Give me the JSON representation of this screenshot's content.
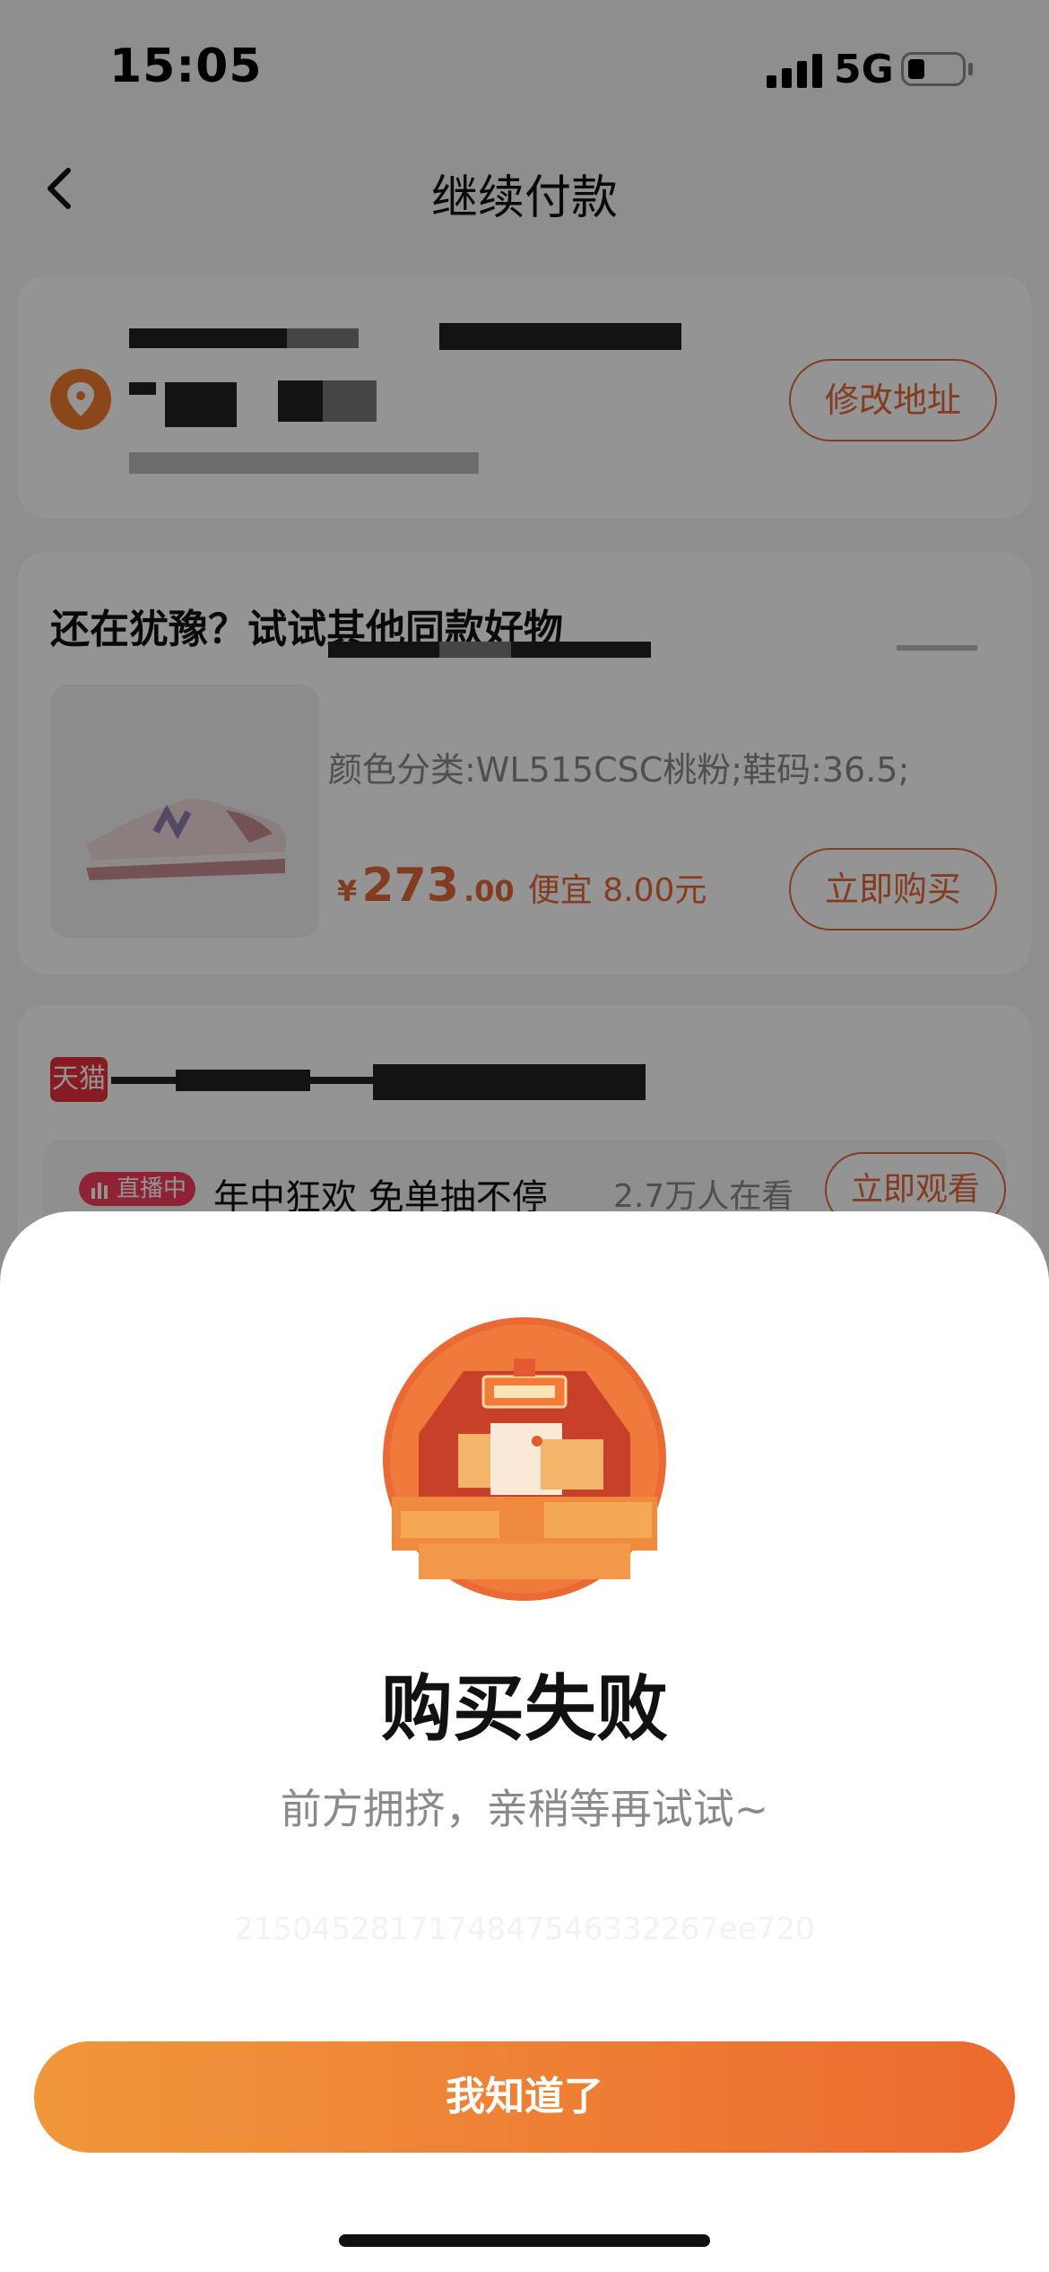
{
  "status_bar": {
    "time": "15:05",
    "network": "5G"
  },
  "nav": {
    "title": "继续付款"
  },
  "address_card": {
    "edit_button": "修改地址"
  },
  "recommendation": {
    "heading": "还在犹豫？试试其他同款好物",
    "variant": "颜色分类:WL515CSC桃粉;鞋码:36.5;",
    "price_symbol": "¥",
    "price_int": "273",
    "price_dec": ".00",
    "price_note": "便宜 8.00元",
    "buy_button": "立即购买"
  },
  "shop": {
    "tag": "天猫",
    "live_badge": "直播中",
    "live_title": "年中狂欢 免单抽不停",
    "viewers": "2.7万人在看",
    "watch_button": "立即观看"
  },
  "dialog": {
    "title": "购买失败",
    "subtitle": "前方拥挤，亲稍等再试试~",
    "trace_id": "2150452817174847546332267ee720",
    "confirm_button": "我知道了"
  },
  "colors": {
    "accent": "#e4683a",
    "button_gradient_start": "#f0973b",
    "button_gradient_end": "#ec6a2f",
    "tmall_red": "#e8303b",
    "live_pink": "#f53d5d"
  }
}
